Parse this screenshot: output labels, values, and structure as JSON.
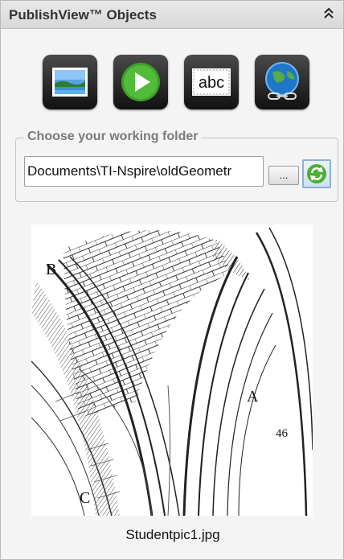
{
  "header": {
    "title": "PublishView™ Objects",
    "collapse_icon": "double-chevron-up-icon"
  },
  "toolbar": {
    "buttons": [
      {
        "name": "insert-image-button",
        "icon": "landscape-image-icon"
      },
      {
        "name": "insert-video-button",
        "icon": "play-icon"
      },
      {
        "name": "insert-text-box-button",
        "icon": "text-box-icon",
        "label": "abc"
      },
      {
        "name": "insert-hyperlink-button",
        "icon": "globe-link-icon"
      }
    ]
  },
  "folder": {
    "legend": "Choose your working folder",
    "path": "Documents\\TI-Nspire\\oldGeometr",
    "browse_label": "...",
    "refresh_icon": "refresh-arrows-icon"
  },
  "preview": {
    "caption": "Studentpic1.jpg",
    "letters": {
      "b": "B",
      "a": "A",
      "c": "C",
      "page_number": "46"
    }
  },
  "colors": {
    "header_bg": "#dcdcdc",
    "refresh_accent": "#3a9a2a",
    "legend_text": "#7b7b7b"
  }
}
